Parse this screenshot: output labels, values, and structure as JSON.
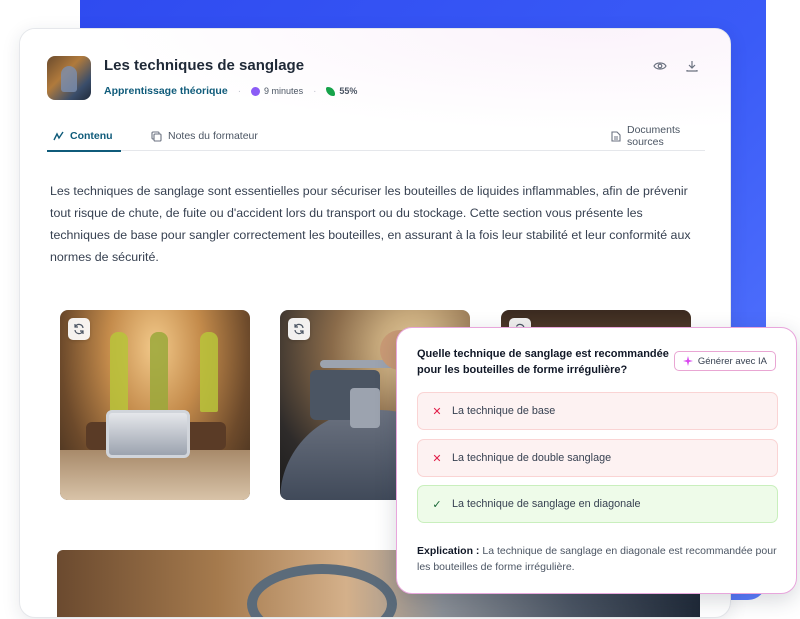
{
  "lesson": {
    "title": "Les techniques de sanglage",
    "category": "Apprentissage théorique",
    "duration": "9 minutes",
    "progress": "55%",
    "thumbnail_icon": "warehouse-photo"
  },
  "tabs": [
    {
      "label": "Contenu",
      "icon": "content-icon",
      "active": true
    },
    {
      "label": "Notes du formateur",
      "icon": "notes-icon",
      "active": false
    },
    {
      "label": "Documents sources",
      "icon": "document-icon",
      "active": false
    }
  ],
  "actions": {
    "view_icon": "eye-icon",
    "download_icon": "download-icon"
  },
  "intro_text": "Les techniques de sanglage sont essentielles pour sécuriser les bouteilles de liquides inflammables, afin de prévenir tout risque de chute, de fuite ou d'accident lors du transport ou du stockage. Cette section vous présente les techniques de base pour sangler correctement les bouteilles, en assurant à la fois leur stabilité et leur conformité aux normes de sécurité.",
  "quiz": {
    "question": "Quelle technique de sanglage est recommandée pour les bouteilles de forme irrégulière?",
    "ai_button": "Générer avec IA",
    "options": [
      {
        "label": "La technique de base",
        "status": "wrong"
      },
      {
        "label": "La technique de double sanglage",
        "status": "wrong"
      },
      {
        "label": "La technique de sanglage en diagonale",
        "status": "correct"
      }
    ],
    "explanation_label": "Explication :",
    "explanation_text": " La technique de sanglage en diagonale est recommandée pour les bouteilles de forme irrégulière."
  },
  "colors": {
    "accent": "#0f5b7a",
    "background_panel": "#3a5bf7",
    "quiz_border": "#e8a6dc",
    "wrong_bg": "#fdf2f2",
    "correct_bg": "#eefbe9"
  }
}
